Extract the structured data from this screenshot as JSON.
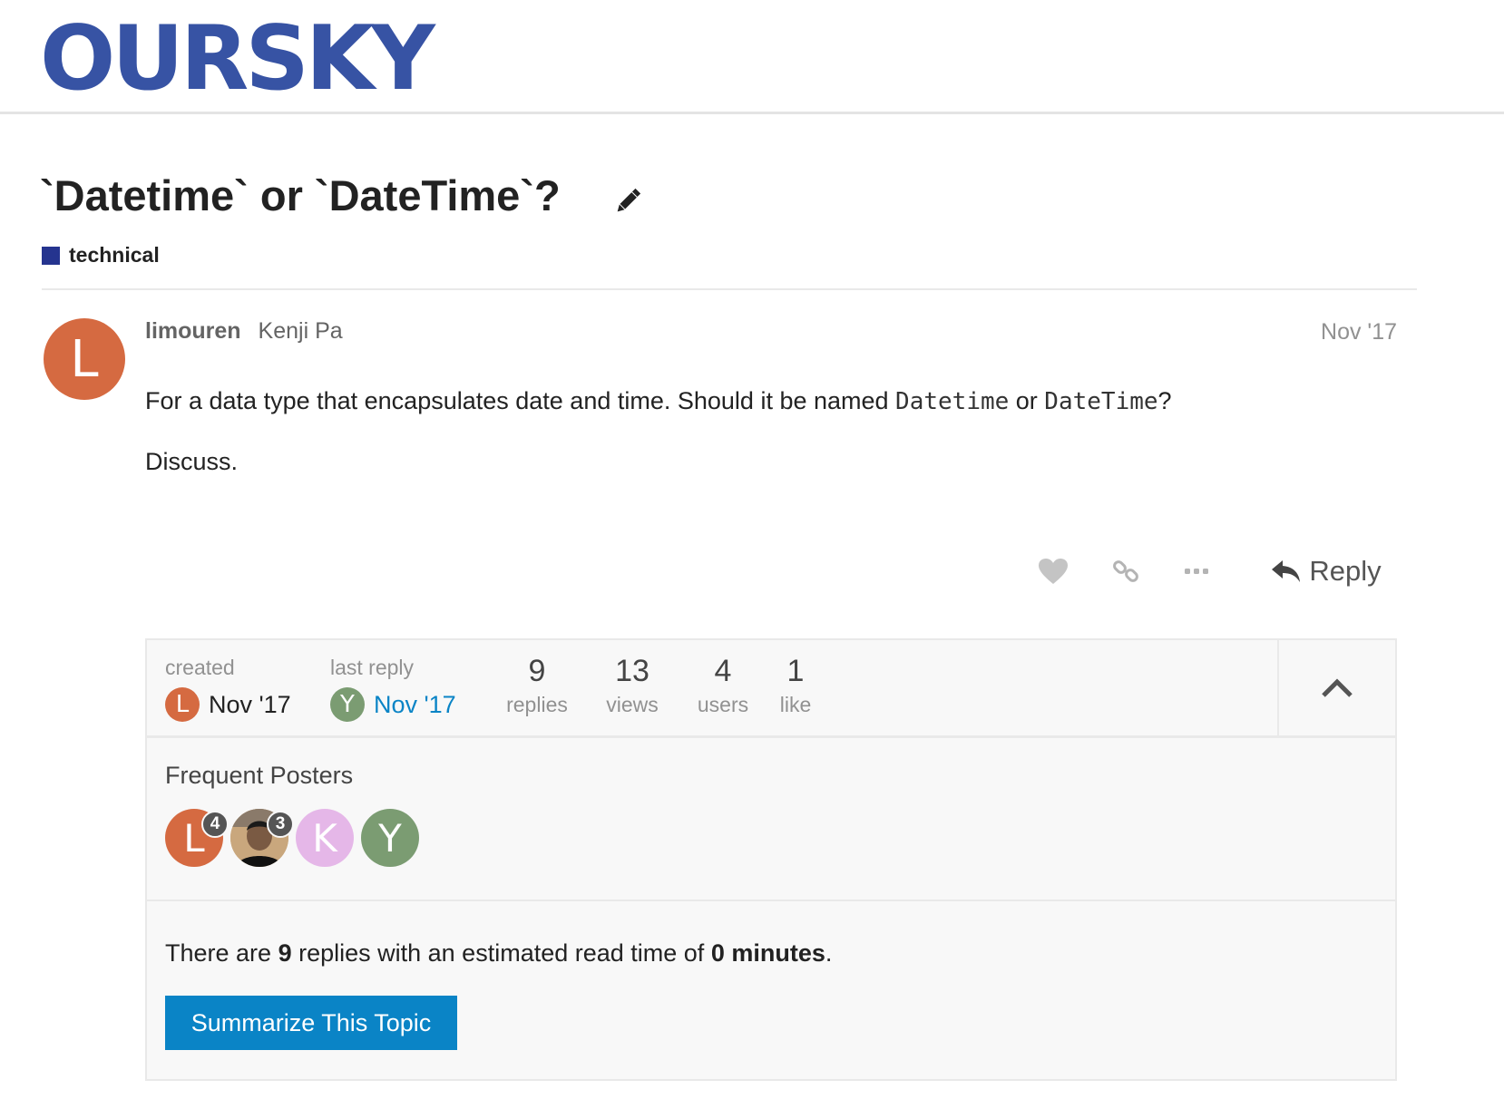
{
  "header": {
    "logo_text": "OURSKY"
  },
  "topic": {
    "title": "`Datetime` or `DateTime`?",
    "category": {
      "name": "technical",
      "color": "#25348f"
    }
  },
  "post": {
    "avatar_letter": "L",
    "avatar_color": "#d56a41",
    "username": "limouren",
    "full_name": "Kenji Pa",
    "date": "Nov '17",
    "body": {
      "line1_prefix": "For a data type that encapsulates date and time. Should it be named ",
      "code1": "Datetime",
      "line1_middle": " or ",
      "code2": "DateTime",
      "line1_suffix": "?",
      "line2": "Discuss."
    },
    "actions": {
      "reply_label": "Reply"
    }
  },
  "topic_map": {
    "created": {
      "label": "created",
      "avatar_letter": "L",
      "avatar_color": "#d56a41",
      "date": "Nov '17"
    },
    "last_reply": {
      "label": "last reply",
      "avatar_letter": "Y",
      "avatar_color": "#7b9c72",
      "date": "Nov '17"
    },
    "stats": [
      {
        "number": "9",
        "label": "replies"
      },
      {
        "number": "13",
        "label": "views"
      },
      {
        "number": "4",
        "label": "users"
      },
      {
        "number": "1",
        "label": "like"
      }
    ],
    "frequent_posters": {
      "title": "Frequent Posters",
      "posters": [
        {
          "letter": "L",
          "color": "#d56a41",
          "count": "4"
        },
        {
          "letter": "",
          "color": "#3a3a3a",
          "count": "3"
        },
        {
          "letter": "K",
          "color": "#e5b7e8",
          "count": ""
        },
        {
          "letter": "Y",
          "color": "#7b9c72",
          "count": ""
        }
      ]
    },
    "summary": {
      "prefix": "There are ",
      "replies": "9",
      "middle": " replies with an estimated read time of ",
      "minutes": "0 minutes",
      "suffix": ".",
      "button_label": "Summarize This Topic"
    }
  }
}
